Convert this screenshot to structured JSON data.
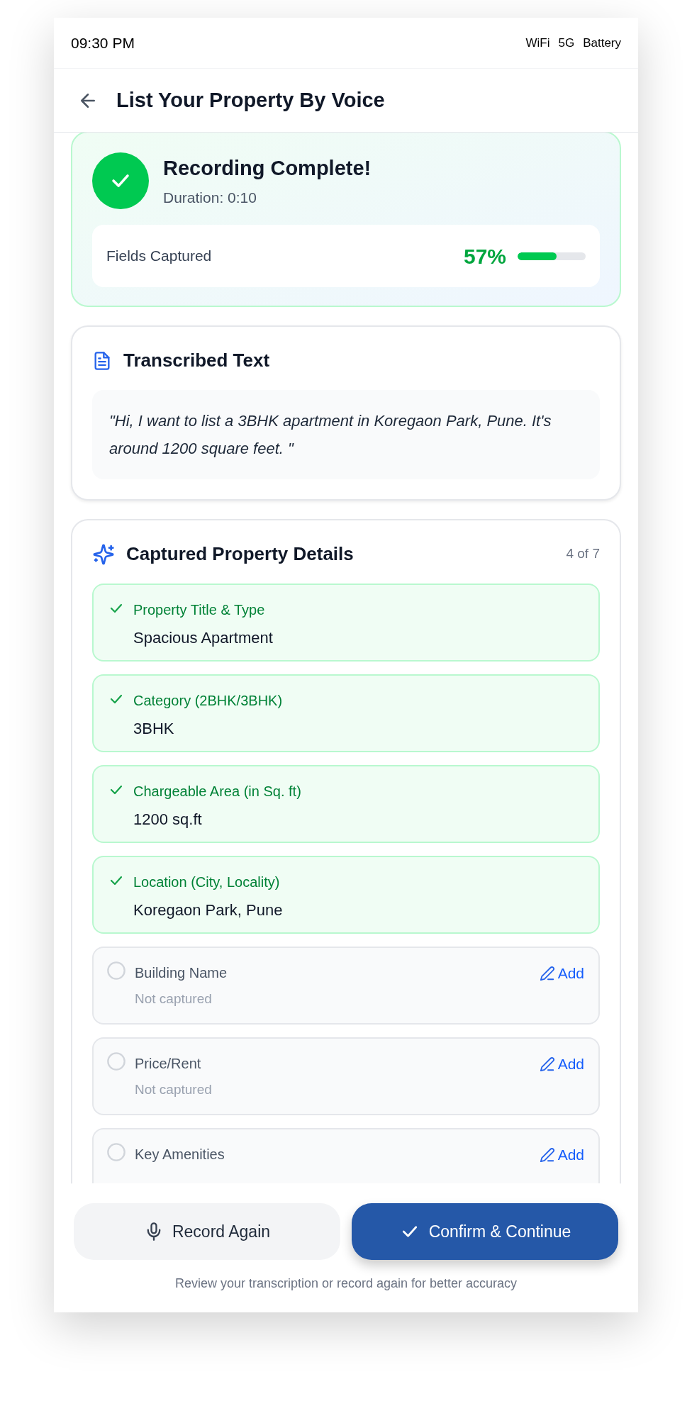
{
  "status_bar": {
    "time": "09:30 PM",
    "indicators": [
      "WiFi",
      "5G",
      "Battery"
    ]
  },
  "header": {
    "title": "List Your Property By Voice"
  },
  "recording": {
    "title": "Recording Complete!",
    "duration": "Duration: 0:10",
    "progress_label": "Fields Captured",
    "percent": "57%",
    "level": 0.57
  },
  "transcript": {
    "title": "Transcribed Text",
    "text": "\"Hi, I want to list a 3BHK apartment in Koregaon Park, Pune. It's around 1200 square feet. \""
  },
  "details": {
    "title": "Captured Property Details",
    "count": "4 of 7",
    "fields": [
      {
        "label": "Property Title & Type",
        "value": "Spacious Apartment",
        "captured": true
      },
      {
        "label": "Category (2BHK/3BHK)",
        "value": "3BHK",
        "captured": true
      },
      {
        "label": "Chargeable Area (in Sq. ft)",
        "value": "1200 sq.ft",
        "captured": true
      },
      {
        "label": "Location (City, Locality)",
        "value": "Koregaon Park, Pune",
        "captured": true
      },
      {
        "label": "Building Name",
        "value": "Not captured",
        "captured": false,
        "action": "Add"
      },
      {
        "label": "Price/Rent",
        "value": "Not captured",
        "captured": false,
        "action": "Add"
      },
      {
        "label": "Key Amenities",
        "captured": false,
        "action": "Add"
      }
    ]
  },
  "footer": {
    "buttons": [
      {
        "label": "Record Again",
        "kind": "secondary"
      },
      {
        "label": "Confirm & Continue",
        "kind": "primary"
      }
    ],
    "hint": "Review your transcription or record again for better accuracy"
  }
}
